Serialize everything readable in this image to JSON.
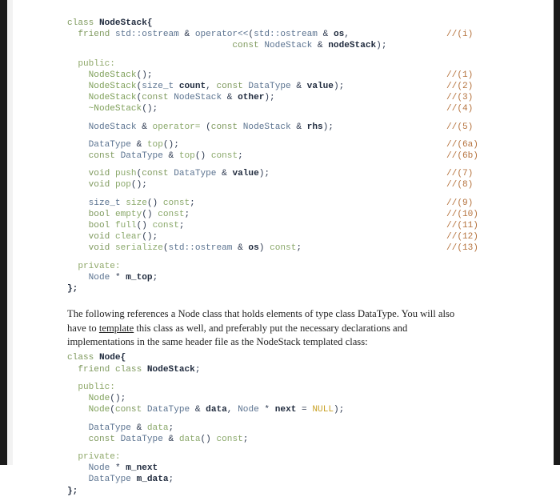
{
  "document": {
    "colors": {
      "keyword": "#7f9a5e",
      "access": "#8fa86a",
      "type": "#5b7390",
      "class_name": "#7fa05a",
      "function": "#8aa86a",
      "identifier": "#1f2a3d",
      "comment": "#b5723d",
      "null_literal": "#c9a227",
      "prose": "#232323",
      "page_background": "#ffffff",
      "scan_edge": "#1b1b1b"
    }
  },
  "code_block_1": {
    "lines": [
      {
        "indent": 0,
        "tokens": [
          {
            "t": "class ",
            "c": "kw"
          },
          {
            "t": "NodeStack",
            "c": "id"
          },
          {
            "t": "{",
            "c": "brace"
          }
        ],
        "comment": ""
      },
      {
        "indent": 1,
        "tokens": [
          {
            "t": "friend ",
            "c": "kw"
          },
          {
            "t": "std::ostream",
            "c": "type"
          },
          {
            "t": " & ",
            "c": "punct"
          },
          {
            "t": "operator<<",
            "c": "type"
          },
          {
            "t": "(",
            "c": "punct"
          },
          {
            "t": "std::ostream",
            "c": "type"
          },
          {
            "t": " & ",
            "c": "punct"
          },
          {
            "t": "os",
            "c": "id"
          },
          {
            "t": ",",
            "c": "punct"
          }
        ],
        "comment": "//(i)"
      },
      {
        "indent": 0,
        "pad": 31,
        "tokens": [
          {
            "t": "const ",
            "c": "kw"
          },
          {
            "t": "NodeStack",
            "c": "type"
          },
          {
            "t": " & ",
            "c": "punct"
          },
          {
            "t": "nodeStack",
            "c": "id"
          },
          {
            "t": ");",
            "c": "punct"
          }
        ],
        "comment": ""
      },
      {
        "blank": true
      },
      {
        "indent": 1,
        "tokens": [
          {
            "t": "public:",
            "c": "kw2"
          }
        ],
        "comment": ""
      },
      {
        "indent": 2,
        "tokens": [
          {
            "t": "NodeStack",
            "c": "cls"
          },
          {
            "t": "();",
            "c": "punct"
          }
        ],
        "comment": "//(1)"
      },
      {
        "indent": 2,
        "tokens": [
          {
            "t": "NodeStack",
            "c": "cls"
          },
          {
            "t": "(",
            "c": "punct"
          },
          {
            "t": "size_t ",
            "c": "type"
          },
          {
            "t": "count",
            "c": "id"
          },
          {
            "t": ", ",
            "c": "punct"
          },
          {
            "t": "const ",
            "c": "kw"
          },
          {
            "t": "DataType",
            "c": "type"
          },
          {
            "t": " & ",
            "c": "punct"
          },
          {
            "t": "value",
            "c": "id"
          },
          {
            "t": ");",
            "c": "punct"
          }
        ],
        "comment": "//(2)"
      },
      {
        "indent": 2,
        "tokens": [
          {
            "t": "NodeStack",
            "c": "cls"
          },
          {
            "t": "(",
            "c": "punct"
          },
          {
            "t": "const ",
            "c": "kw"
          },
          {
            "t": "NodeStack",
            "c": "type"
          },
          {
            "t": " & ",
            "c": "punct"
          },
          {
            "t": "other",
            "c": "id"
          },
          {
            "t": ");",
            "c": "punct"
          }
        ],
        "comment": "//(3)"
      },
      {
        "indent": 2,
        "tokens": [
          {
            "t": "~NodeStack",
            "c": "cls"
          },
          {
            "t": "();",
            "c": "punct"
          }
        ],
        "comment": "//(4)"
      },
      {
        "blank": true
      },
      {
        "indent": 2,
        "tokens": [
          {
            "t": "NodeStack",
            "c": "type"
          },
          {
            "t": " & ",
            "c": "punct"
          },
          {
            "t": "operator=",
            "c": "fn"
          },
          {
            "t": " (",
            "c": "punct"
          },
          {
            "t": "const ",
            "c": "kw"
          },
          {
            "t": "NodeStack",
            "c": "type"
          },
          {
            "t": " & ",
            "c": "punct"
          },
          {
            "t": "rhs",
            "c": "id"
          },
          {
            "t": ");",
            "c": "punct"
          }
        ],
        "comment": "//(5)"
      },
      {
        "blank": true
      },
      {
        "indent": 2,
        "tokens": [
          {
            "t": "DataType",
            "c": "type"
          },
          {
            "t": " & ",
            "c": "punct"
          },
          {
            "t": "top",
            "c": "fn"
          },
          {
            "t": "();",
            "c": "punct"
          }
        ],
        "comment": "//(6a)"
      },
      {
        "indent": 2,
        "tokens": [
          {
            "t": "const ",
            "c": "kw"
          },
          {
            "t": "DataType",
            "c": "type"
          },
          {
            "t": " & ",
            "c": "punct"
          },
          {
            "t": "top",
            "c": "fn"
          },
          {
            "t": "() ",
            "c": "punct"
          },
          {
            "t": "const",
            "c": "fn"
          },
          {
            "t": ";",
            "c": "punct"
          }
        ],
        "comment": "//(6b)"
      },
      {
        "blank": true
      },
      {
        "indent": 2,
        "tokens": [
          {
            "t": "void ",
            "c": "kw"
          },
          {
            "t": "push",
            "c": "fn"
          },
          {
            "t": "(",
            "c": "punct"
          },
          {
            "t": "const ",
            "c": "kw"
          },
          {
            "t": "DataType",
            "c": "type"
          },
          {
            "t": " & ",
            "c": "punct"
          },
          {
            "t": "value",
            "c": "id"
          },
          {
            "t": ");",
            "c": "punct"
          }
        ],
        "comment": "//(7)"
      },
      {
        "indent": 2,
        "tokens": [
          {
            "t": "void ",
            "c": "kw"
          },
          {
            "t": "pop",
            "c": "fn"
          },
          {
            "t": "();",
            "c": "punct"
          }
        ],
        "comment": "//(8)"
      },
      {
        "blank": true
      },
      {
        "indent": 2,
        "tokens": [
          {
            "t": "size_t ",
            "c": "type"
          },
          {
            "t": "size",
            "c": "fn"
          },
          {
            "t": "() ",
            "c": "punct"
          },
          {
            "t": "const",
            "c": "fn"
          },
          {
            "t": ";",
            "c": "punct"
          }
        ],
        "comment": "//(9)"
      },
      {
        "indent": 2,
        "tokens": [
          {
            "t": "bool ",
            "c": "kw"
          },
          {
            "t": "empty",
            "c": "fn"
          },
          {
            "t": "() ",
            "c": "punct"
          },
          {
            "t": "const",
            "c": "fn"
          },
          {
            "t": ";",
            "c": "punct"
          }
        ],
        "comment": "//(10)"
      },
      {
        "indent": 2,
        "tokens": [
          {
            "t": "bool ",
            "c": "kw"
          },
          {
            "t": "full",
            "c": "fn"
          },
          {
            "t": "() ",
            "c": "punct"
          },
          {
            "t": "const",
            "c": "fn"
          },
          {
            "t": ";",
            "c": "punct"
          }
        ],
        "comment": "//(11)"
      },
      {
        "indent": 2,
        "tokens": [
          {
            "t": "void ",
            "c": "kw"
          },
          {
            "t": "clear",
            "c": "fn"
          },
          {
            "t": "();",
            "c": "punct"
          }
        ],
        "comment": "//(12)"
      },
      {
        "indent": 2,
        "tokens": [
          {
            "t": "void ",
            "c": "kw"
          },
          {
            "t": "serialize",
            "c": "fn"
          },
          {
            "t": "(",
            "c": "punct"
          },
          {
            "t": "std::ostream",
            "c": "type"
          },
          {
            "t": " & ",
            "c": "punct"
          },
          {
            "t": "os",
            "c": "id"
          },
          {
            "t": ") ",
            "c": "punct"
          },
          {
            "t": "const",
            "c": "fn"
          },
          {
            "t": ";",
            "c": "punct"
          }
        ],
        "comment": "//(13)"
      },
      {
        "blank": true
      },
      {
        "indent": 1,
        "tokens": [
          {
            "t": "private:",
            "c": "kw2"
          }
        ],
        "comment": ""
      },
      {
        "indent": 2,
        "tokens": [
          {
            "t": "Node",
            "c": "type"
          },
          {
            "t": " * ",
            "c": "punct"
          },
          {
            "t": "m_top",
            "c": "id"
          },
          {
            "t": ";",
            "c": "punct"
          }
        ],
        "comment": ""
      },
      {
        "indent": 0,
        "tokens": [
          {
            "t": "};",
            "c": "brace"
          }
        ],
        "comment": ""
      }
    ]
  },
  "paragraph": {
    "part1": "The following references a Node class that holds elements of type class DataType. You will also have to ",
    "spellchecked_word": "template",
    "part2": " this class as well, and preferably put the necessary declarations and implementations in the same header file as the NodeStack templated class:"
  },
  "code_block_2": {
    "lines": [
      {
        "indent": 0,
        "tokens": [
          {
            "t": "class ",
            "c": "kw"
          },
          {
            "t": "Node",
            "c": "id"
          },
          {
            "t": "{",
            "c": "brace"
          }
        ],
        "comment": ""
      },
      {
        "indent": 1,
        "tokens": [
          {
            "t": "friend ",
            "c": "kw"
          },
          {
            "t": "class ",
            "c": "kw"
          },
          {
            "t": "NodeStack",
            "c": "id"
          },
          {
            "t": ";",
            "c": "punct"
          }
        ],
        "comment": ""
      },
      {
        "blank": true
      },
      {
        "indent": 1,
        "tokens": [
          {
            "t": "public:",
            "c": "kw2"
          }
        ],
        "comment": ""
      },
      {
        "indent": 2,
        "tokens": [
          {
            "t": "Node",
            "c": "cls"
          },
          {
            "t": "();",
            "c": "punct"
          }
        ],
        "comment": ""
      },
      {
        "indent": 2,
        "tokens": [
          {
            "t": "Node",
            "c": "cls"
          },
          {
            "t": "(",
            "c": "punct"
          },
          {
            "t": "const ",
            "c": "kw"
          },
          {
            "t": "DataType",
            "c": "type"
          },
          {
            "t": " & ",
            "c": "punct"
          },
          {
            "t": "data",
            "c": "id"
          },
          {
            "t": ", ",
            "c": "punct"
          },
          {
            "t": "Node",
            "c": "type"
          },
          {
            "t": " * ",
            "c": "punct"
          },
          {
            "t": "next",
            "c": "id"
          },
          {
            "t": " = ",
            "c": "punct"
          },
          {
            "t": "NULL",
            "c": "nul"
          },
          {
            "t": ");",
            "c": "punct"
          }
        ],
        "comment": ""
      },
      {
        "blank": true
      },
      {
        "indent": 2,
        "tokens": [
          {
            "t": "DataType",
            "c": "type"
          },
          {
            "t": " & ",
            "c": "punct"
          },
          {
            "t": "data",
            "c": "fn"
          },
          {
            "t": ";",
            "c": "punct"
          }
        ],
        "comment": ""
      },
      {
        "indent": 2,
        "tokens": [
          {
            "t": "const ",
            "c": "kw"
          },
          {
            "t": "DataType",
            "c": "type"
          },
          {
            "t": " & ",
            "c": "punct"
          },
          {
            "t": "data",
            "c": "fn"
          },
          {
            "t": "() ",
            "c": "punct"
          },
          {
            "t": "const",
            "c": "fn"
          },
          {
            "t": ";",
            "c": "punct"
          }
        ],
        "comment": ""
      },
      {
        "blank": true
      },
      {
        "indent": 1,
        "tokens": [
          {
            "t": "private:",
            "c": "kw2"
          }
        ],
        "comment": ""
      },
      {
        "indent": 2,
        "tokens": [
          {
            "t": "Node",
            "c": "type"
          },
          {
            "t": " * ",
            "c": "punct"
          },
          {
            "t": "m_next",
            "c": "id"
          }
        ],
        "comment": ""
      },
      {
        "indent": 2,
        "tokens": [
          {
            "t": "DataType ",
            "c": "type"
          },
          {
            "t": "m_data",
            "c": "id"
          },
          {
            "t": ";",
            "c": "punct"
          }
        ],
        "comment": ""
      },
      {
        "indent": 0,
        "tokens": [
          {
            "t": "};",
            "c": "brace"
          }
        ],
        "comment": ""
      }
    ]
  }
}
